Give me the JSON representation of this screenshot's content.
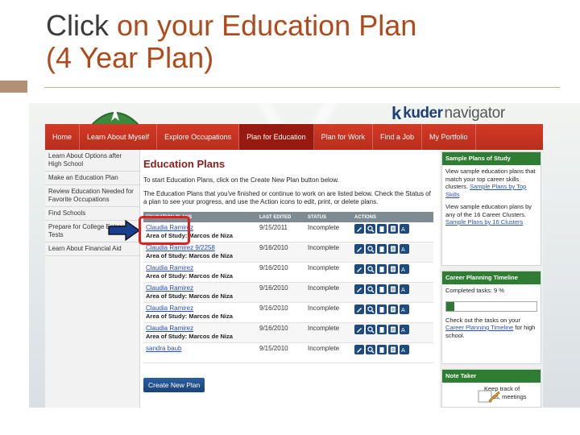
{
  "slide": {
    "title_line1_a": "Click ",
    "title_line1_b": "on your Education Plan",
    "title_line2": "(4 Year Plan)"
  },
  "brand": {
    "k": "k",
    "kuder": "kuder",
    "navigator": "navigator"
  },
  "nav": [
    "Home",
    "Learn About Myself",
    "Explore Occupations",
    "Plan for Education",
    "Plan for Work",
    "Find a Job",
    "My Portfolio"
  ],
  "nav_active": "Plan for Education",
  "leftnav": [
    "Learn About Options after High School",
    "Make an Education Plan",
    "Review Education Needed for Favorite Occupations",
    "Find Schools",
    "Prepare for College Entrance Tests",
    "Learn About Financial Aid"
  ],
  "main": {
    "title": "Education Plans",
    "intro1": "To start Education Plans, click on the Create New Plan button below.",
    "intro2": "The Education Plans that you've finished or continue to work on are listed below. Check the Status of a plan to see your progress, and use the Action icons to edit, print, or delete plans.",
    "columns": [
      "EDUCATION PLANS",
      "LAST EDITED",
      "STATUS",
      "ACTIONS"
    ],
    "rows": [
      {
        "name": "Claudia Ramirez",
        "area": "Area of Study: Marcos de Niza",
        "date": "9/15/2011",
        "status": "Incomplete"
      },
      {
        "name": "Claudia Ramirez 9/2258",
        "area": "Area of Study: Marcos de Niza",
        "date": "9/16/2010",
        "status": "Incomplete"
      },
      {
        "name": "Claudia Ramirez",
        "area": "Area of Study: Marcos de Niza",
        "date": "9/16/2010",
        "status": "Incomplete"
      },
      {
        "name": "Claudia Ramirez",
        "area": "Area of Study: Marcos de Niza",
        "date": "9/16/2010",
        "status": "Incomplete"
      },
      {
        "name": "Claudia Ramirez",
        "area": "Area of Study: Marcos de Niza",
        "date": "9/16/2010",
        "status": "Incomplete"
      },
      {
        "name": "Claudia Ramirez",
        "area": "Area of Study: Marcos de Niza",
        "date": "9/16/2010",
        "status": "Incomplete"
      },
      {
        "name": "sandra baub",
        "area": "",
        "date": "9/15/2010",
        "status": "Incomplete"
      }
    ],
    "action_icons": [
      "edit-icon",
      "view-icon",
      "delete-icon",
      "print-icon",
      "text-size-icon"
    ],
    "create_button": "Create New Plan"
  },
  "sidebar": {
    "sample_title": "Sample Plans of Study",
    "sample_text1": "View sample education plans that match your top career skills clusters. ",
    "sample_link1": "Sample Plans by Top Skills",
    "sample_text2": "View sample education plans by any of the 16 Career Clusters. ",
    "sample_link2": "Sample Plans by 16 Clusters",
    "timeline_title": "Career Planning Timeline",
    "completed_label": "Completed tasks: 9 %",
    "completed_fraction": 0.09,
    "timeline_text": "Check out the tasks on your ",
    "timeline_link": "Career Planning Timeline",
    "timeline_text_end": " for high school.",
    "note_title": "Note Taker",
    "note_text": "Keep track of ideas, meetings"
  },
  "colors": {
    "nav_red": "#c8321f",
    "active_red": "#97190f",
    "side_green": "#2f7d32",
    "highlight": "#e0201c",
    "link_blue": "#2a4fbf"
  }
}
